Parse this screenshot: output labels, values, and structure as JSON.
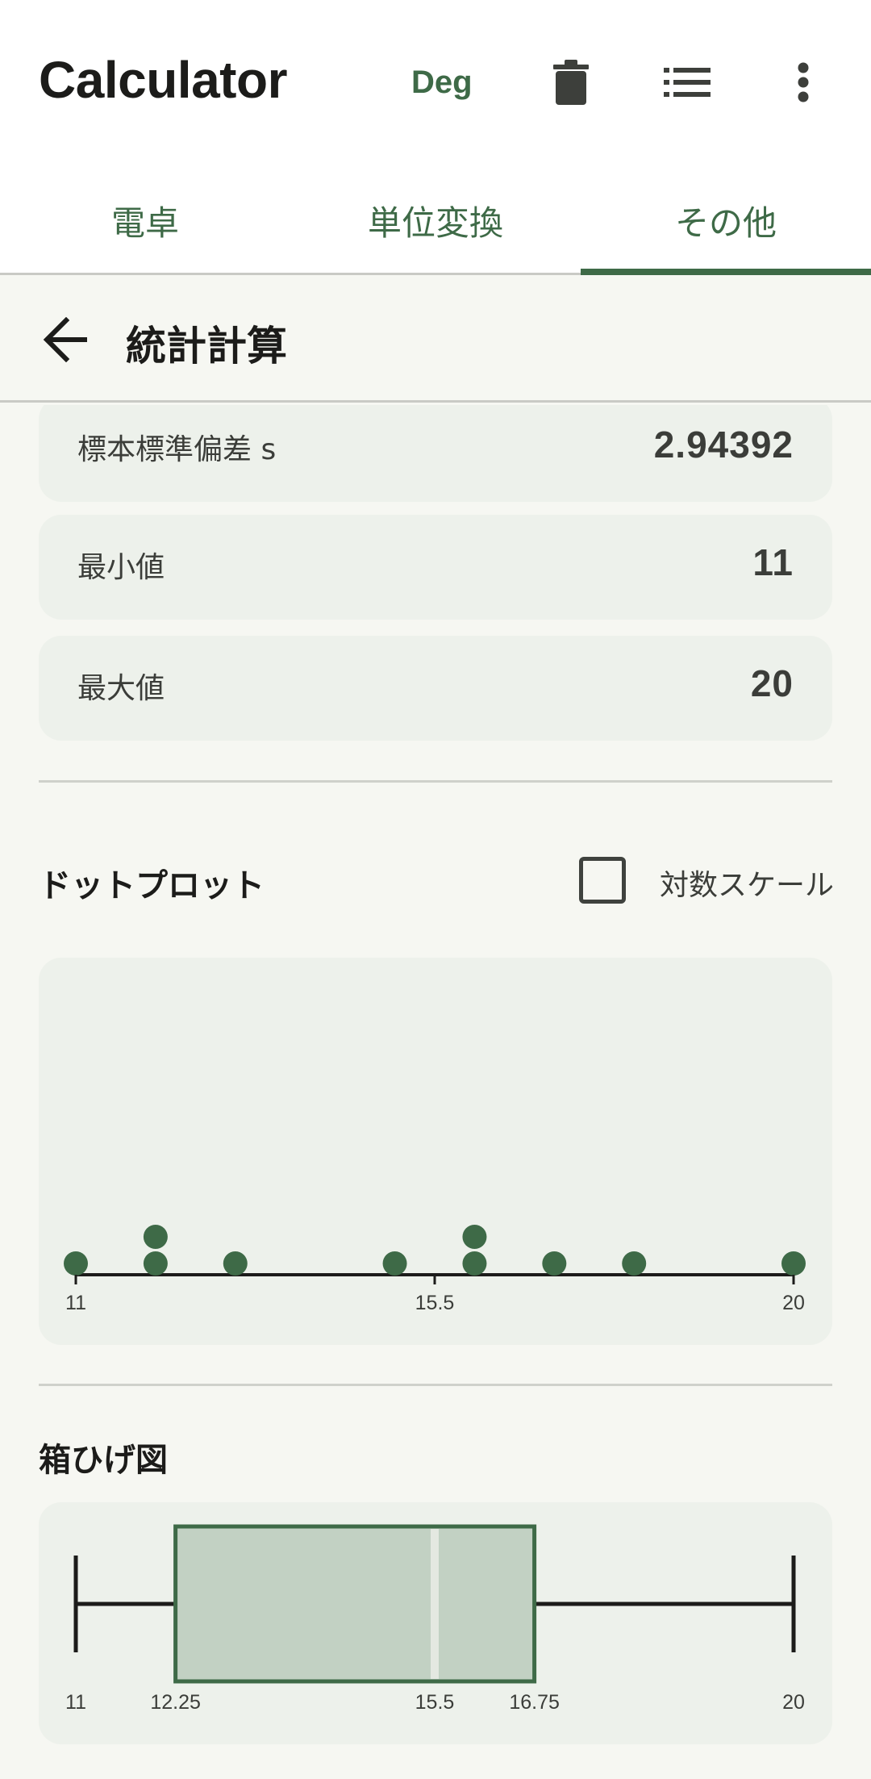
{
  "app": {
    "title": "Calculator",
    "angle_mode": "Deg"
  },
  "toolbar_icons": [
    "trash-icon",
    "list-icon",
    "more-vert-icon"
  ],
  "tabs": [
    {
      "label": "電卓",
      "selected": false
    },
    {
      "label": "単位変換",
      "selected": false
    },
    {
      "label": "その他",
      "selected": true
    }
  ],
  "subheader": {
    "title": "統計計算"
  },
  "stats": [
    {
      "label": "標本標準偏差 s",
      "value": "2.94392"
    },
    {
      "label": "最小値",
      "value": "11"
    },
    {
      "label": "最大値",
      "value": "20"
    }
  ],
  "dot_plot": {
    "title": "ドットプロット",
    "log_scale_label": "対数スケール",
    "log_scale_checked": false
  },
  "box_plot": {
    "title": "箱ひげ図"
  },
  "colors": {
    "accent": "#3e6a47",
    "card": "#edf1eb",
    "background": "#f6f7f2",
    "box_fill": "#c2d1c3"
  },
  "chart_data": [
    {
      "type": "scatter",
      "subtype": "dot-plot",
      "x_ticks": [
        "11",
        "15.5",
        "20"
      ],
      "xlim": [
        11,
        20
      ],
      "values": [
        11,
        12,
        12,
        13,
        15,
        16,
        16,
        17,
        18,
        20
      ]
    },
    {
      "type": "box",
      "min": 11,
      "q1": 12.25,
      "median": 15.5,
      "q3": 16.75,
      "max": 20,
      "tick_labels": [
        "11",
        "12.25",
        "15.5",
        "16.75",
        "20"
      ]
    }
  ]
}
